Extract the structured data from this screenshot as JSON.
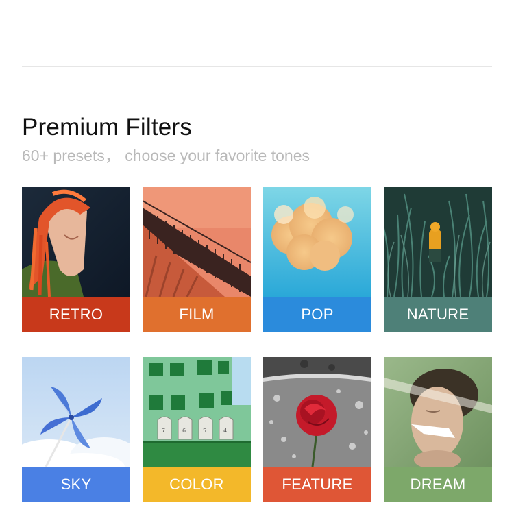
{
  "section": {
    "title": "Premium Filters",
    "subtitle": "60+ presets， choose your favorite tones"
  },
  "filters": [
    {
      "label": "RETRO",
      "color": "#c8391b",
      "icon": "woman-red-braids-photo"
    },
    {
      "label": "FILM",
      "color": "#e0702e",
      "icon": "staircase-wall-photo"
    },
    {
      "label": "POP",
      "color": "#2b8bdc",
      "icon": "color-smoke-cloud-photo"
    },
    {
      "label": "NATURE",
      "color": "#4e8078",
      "icon": "grass-field-figure-photo"
    },
    {
      "label": "SKY",
      "color": "#4a80e4",
      "icon": "pinwheel-sky-photo"
    },
    {
      "label": "COLOR",
      "color": "#f3b82a",
      "icon": "mailboxes-building-photo"
    },
    {
      "label": "FEATURE",
      "color": "#df5636",
      "icon": "rose-water-photo"
    },
    {
      "label": "DREAM",
      "color": "#7da86a",
      "icon": "dreamy-portrait-photo"
    }
  ]
}
